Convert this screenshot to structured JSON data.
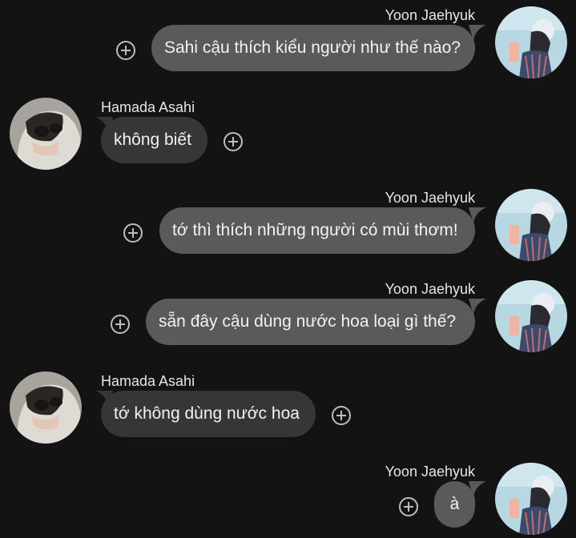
{
  "messages": [
    {
      "sender": "Yoon Jaehyuk",
      "text": "Sahi cậu thích kiểu người như thế nào?"
    },
    {
      "sender": "Hamada Asahi",
      "text": "không biết"
    },
    {
      "sender": "Yoon Jaehyuk",
      "text": "tớ thì thích những người có mùi thơm!"
    },
    {
      "sender": "Yoon Jaehyuk",
      "text": "sẵn đây cậu dùng nước hoa loại gì thế?"
    },
    {
      "sender": "Hamada Asahi",
      "text": "tớ không dùng nước hoa"
    },
    {
      "sender": "Yoon Jaehyuk",
      "text": "à"
    }
  ],
  "colors": {
    "background": "#131313",
    "outgoing_bubble": "#5a5a5a",
    "incoming_bubble": "#363636",
    "text": "#f2f2f2"
  },
  "icons": {
    "add": "plus-circle-icon",
    "avatar_yoon": "avatar-yoon-jaehyuk",
    "avatar_asahi": "avatar-hamada-asahi"
  }
}
